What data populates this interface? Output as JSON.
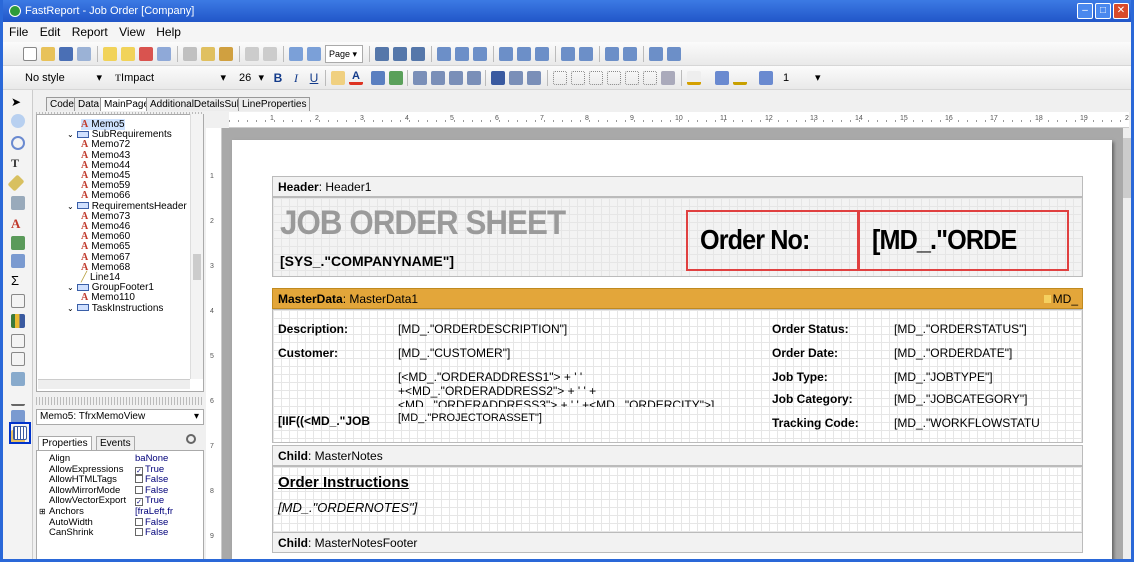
{
  "window": {
    "title": "FastReport - Job Order [Company]"
  },
  "menu": [
    "File",
    "Edit",
    "Report",
    "View",
    "Help"
  ],
  "toolbar": {
    "page_btn": "Page ▾"
  },
  "formatbar": {
    "style": "No style",
    "font": "Impact",
    "size": "26",
    "line_width": "1"
  },
  "designer_tabs": [
    "Code",
    "Data",
    "MainPage",
    "AdditionalDetailsSub",
    "LineProperties"
  ],
  "tree": [
    {
      "label": "Memo5",
      "type": "memo"
    },
    {
      "label": "SubRequirements",
      "type": "band"
    },
    {
      "label": "Memo72",
      "type": "memo"
    },
    {
      "label": "Memo43",
      "type": "memo"
    },
    {
      "label": "Memo44",
      "type": "memo"
    },
    {
      "label": "Memo45",
      "type": "memo"
    },
    {
      "label": "Memo59",
      "type": "memo"
    },
    {
      "label": "Memo66",
      "type": "memo"
    },
    {
      "label": "RequirementsHeader",
      "type": "band"
    },
    {
      "label": "Memo73",
      "type": "memo"
    },
    {
      "label": "Memo46",
      "type": "memo"
    },
    {
      "label": "Memo60",
      "type": "memo"
    },
    {
      "label": "Memo65",
      "type": "memo"
    },
    {
      "label": "Memo67",
      "type": "memo"
    },
    {
      "label": "Memo68",
      "type": "memo"
    },
    {
      "label": "Line14",
      "type": "line"
    },
    {
      "label": "GroupFooter1",
      "type": "band"
    },
    {
      "label": "Memo110",
      "type": "memo"
    },
    {
      "label": "TaskInstructions",
      "type": "band"
    }
  ],
  "object_inspector": {
    "selected": "Memo5: TfrxMemoView",
    "tabs": [
      "Properties",
      "Events"
    ],
    "properties": [
      {
        "name": "Align",
        "value": "baNone"
      },
      {
        "name": "AllowExpressions",
        "value": "True",
        "checked": true
      },
      {
        "name": "AllowHTMLTags",
        "value": "False",
        "checked": false
      },
      {
        "name": "AllowMirrorMode",
        "value": "False",
        "checked": false
      },
      {
        "name": "AllowVectorExport",
        "value": "True",
        "checked": true
      },
      {
        "name": "Anchors",
        "value": "[fraLeft,fr",
        "expand": true
      },
      {
        "name": "AutoWidth",
        "value": "False",
        "checked": false
      },
      {
        "name": "CanShrink",
        "value": "False",
        "checked": false
      }
    ]
  },
  "report": {
    "header_band": "Header",
    "header_name": "Header1",
    "title": "JOB ORDER SHEET",
    "company": "[SYS_.\"COMPANYNAME\"]",
    "order_no_label": "Order No:",
    "order_no_value": "[MD_.\"ORDE",
    "master_band": "MasterData",
    "master_name": "MasterData1",
    "master_ds": "MD_",
    "left_labels": [
      "Description:",
      "Customer:"
    ],
    "left_values": [
      "[MD_.\"ORDERDESCRIPTION\"]",
      "[MD_.\"CUSTOMER\"]"
    ],
    "address": [
      "[<MD_.\"ORDERADDRESS1\"> + ' '",
      "+<MD_.\"ORDERADDRESS2\"> + ' ' +",
      "<MD_.\"ORDERADDRESS3\"> + ' ' +<MD_.\"ORDERCITY\">]"
    ],
    "iif_label": "[IIF((<MD_.\"JOB",
    "project_value": "[MD_.\"PROJECTORASSET\"]",
    "right_labels": [
      "Order Status:",
      "Order Date:",
      "Job Type:",
      "Job Category:",
      "Tracking Code:"
    ],
    "right_values": [
      "[MD_.\"ORDERSTATUS\"]",
      "[MD_.\"ORDERDATE\"]",
      "[MD_.\"JOBTYPE\"]",
      "[MD_.\"JOBCATEGORY\"]",
      "[MD_.\"WORKFLOWSTATU"
    ],
    "child1_band": "Child",
    "child1_name": "MasterNotes",
    "instructions_title": "Order Instructions",
    "notes_value": "[MD_.\"ORDERNOTES\"]",
    "child2_band": "Child",
    "child2_name": "MasterNotesFooter"
  }
}
